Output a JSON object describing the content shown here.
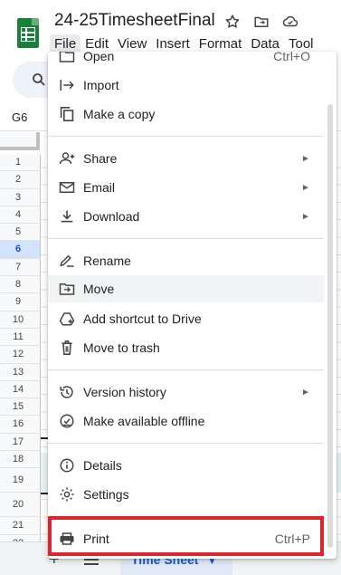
{
  "header": {
    "doc_title": "24-25TimesheetFinal",
    "icons": [
      "star-icon",
      "move-to-folder-icon",
      "cloud-status-icon"
    ]
  },
  "menubar": [
    "File",
    "Edit",
    "View",
    "Insert",
    "Format",
    "Data",
    "Tool"
  ],
  "namebox": "G6",
  "rows": [
    "1",
    "2",
    "3",
    "4",
    "5",
    "6",
    "7",
    "8",
    "9",
    "10",
    "11",
    "12",
    "13",
    "14",
    "15",
    "16",
    "17",
    "18",
    "19",
    "20",
    "21",
    "22",
    "23"
  ],
  "selected_row": "6",
  "sheetbar": {
    "add_icon": "plus-icon",
    "list_icon": "hamburger-icon",
    "active_sheet": "Time Sheet"
  },
  "file_menu": {
    "open": {
      "label": "Open",
      "shortcut": "Ctrl+O"
    },
    "import": {
      "label": "Import"
    },
    "make_copy": {
      "label": "Make a copy"
    },
    "share": {
      "label": "Share"
    },
    "email": {
      "label": "Email"
    },
    "download": {
      "label": "Download"
    },
    "rename": {
      "label": "Rename"
    },
    "move": {
      "label": "Move"
    },
    "add_shortcut": {
      "label": "Add shortcut to Drive"
    },
    "trash": {
      "label": "Move to trash"
    },
    "version_history": {
      "label": "Version history"
    },
    "offline": {
      "label": "Make available offline"
    },
    "details": {
      "label": "Details"
    },
    "settings": {
      "label": "Settings"
    },
    "print": {
      "label": "Print",
      "shortcut": "Ctrl+P"
    }
  },
  "colors": {
    "sheets_green": "#188038",
    "highlight_red": "#e0242b",
    "active_blue": "#0b57d0"
  }
}
